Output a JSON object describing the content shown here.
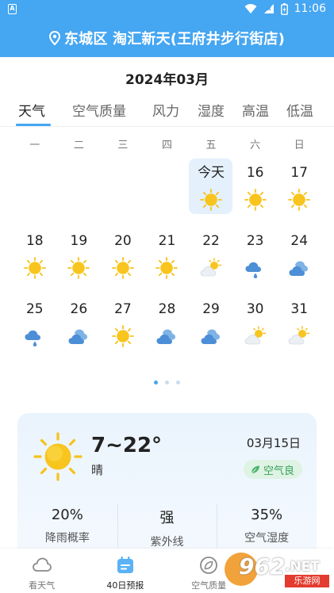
{
  "status_bar": {
    "time": "11:06",
    "app_badge": "A",
    "icons": [
      "wifi-icon",
      "signal-icon",
      "battery-icon"
    ]
  },
  "header": {
    "location": "东城区 淘汇新天(王府井步行街店)",
    "icon": "location-pin-icon"
  },
  "month_title": "2024年03月",
  "tabs": [
    {
      "label": "天气",
      "active": true
    },
    {
      "label": "空气质量",
      "active": false
    },
    {
      "label": "风力",
      "active": false
    },
    {
      "label": "湿度",
      "active": false
    },
    {
      "label": "高温",
      "active": false
    },
    {
      "label": "低温",
      "active": false
    }
  ],
  "weekdays": [
    "一",
    "二",
    "三",
    "四",
    "五",
    "六",
    "日"
  ],
  "calendar": [
    {
      "day": "",
      "icon": ""
    },
    {
      "day": "",
      "icon": ""
    },
    {
      "day": "",
      "icon": ""
    },
    {
      "day": "",
      "icon": ""
    },
    {
      "day": "今天",
      "icon": "sunny",
      "today": true
    },
    {
      "day": "16",
      "icon": "sunny"
    },
    {
      "day": "17",
      "icon": "sunny"
    },
    {
      "day": "18",
      "icon": "sunny"
    },
    {
      "day": "19",
      "icon": "sunny"
    },
    {
      "day": "20",
      "icon": "sunny"
    },
    {
      "day": "21",
      "icon": "sunny"
    },
    {
      "day": "22",
      "icon": "partly-cloudy"
    },
    {
      "day": "23",
      "icon": "rain"
    },
    {
      "day": "24",
      "icon": "cloudy"
    },
    {
      "day": "25",
      "icon": "rain"
    },
    {
      "day": "26",
      "icon": "cloudy"
    },
    {
      "day": "27",
      "icon": "sunny"
    },
    {
      "day": "28",
      "icon": "cloudy"
    },
    {
      "day": "29",
      "icon": "cloudy"
    },
    {
      "day": "30",
      "icon": "partly-cloudy"
    },
    {
      "day": "31",
      "icon": "partly-cloudy"
    }
  ],
  "pager": {
    "count": 3,
    "active_index": 0
  },
  "card": {
    "temp_range": "7~22°",
    "condition": "晴",
    "date": "03月15日",
    "aqi_label": "空气良",
    "stats": [
      {
        "value": "20%",
        "label": "降雨概率"
      },
      {
        "value": "强",
        "label": "紫外线"
      },
      {
        "value": "35%",
        "label": "空气湿度"
      }
    ]
  },
  "bottom_nav": [
    {
      "label": "看天气",
      "icon": "cloud-outline-icon",
      "active": false
    },
    {
      "label": "40日预报",
      "icon": "calendar-icon",
      "active": true
    },
    {
      "label": "空气质量",
      "icon": "leaf-circle-icon",
      "active": false
    },
    {
      "label": "",
      "icon": "",
      "active": false
    }
  ],
  "watermark": {
    "brand": "962",
    "suffix": ".NET",
    "sub": "乐游网"
  },
  "colors": {
    "primary": "#45a6f2",
    "sun": "#f6c21b",
    "cloud": "#4d8fd6",
    "aqi_green": "#38a15a"
  }
}
